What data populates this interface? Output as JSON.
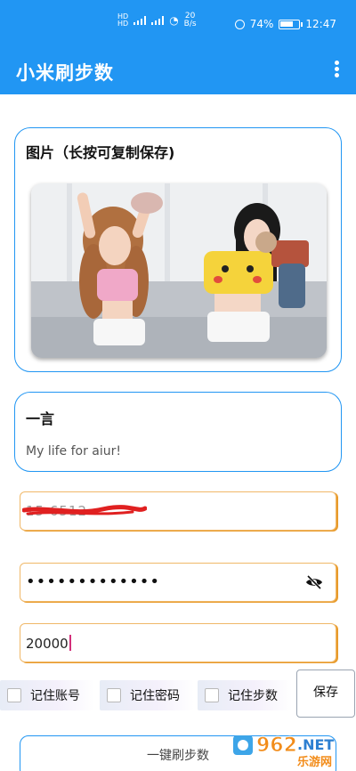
{
  "status_bar": {
    "net_speed": "20",
    "net_unit": "B/s",
    "battery": "74%",
    "battery_level": 0.74,
    "time": "12:47"
  },
  "app_bar": {
    "title": "小米刷步数",
    "menu_icon": "more-vert-icon"
  },
  "image_card": {
    "title": "图片（长按可复制保存)"
  },
  "quote_card": {
    "title": "一言",
    "text": "My life for aiur!"
  },
  "form": {
    "phone_value": "15        6512",
    "password_value": "•••••••••••••",
    "steps_value": "20000"
  },
  "options": {
    "remember_account": "记住账号",
    "remember_password": "记住密码",
    "remember_steps": "记住步数",
    "save": "保存"
  },
  "actions": {
    "one_click": "一键刷步数"
  },
  "watermark": {
    "number": "962",
    "suffix": ".NET",
    "subtitle": "乐游网"
  },
  "colors": {
    "primary": "#2196f3",
    "field_border": "#f0b868"
  }
}
